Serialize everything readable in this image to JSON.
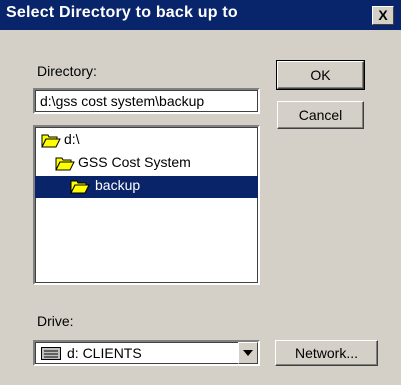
{
  "window": {
    "title": "Select Directory to back up to",
    "close_label": "X"
  },
  "directory": {
    "label": "Directory:",
    "value": "d:\\gss cost system\\backup"
  },
  "tree": {
    "items": [
      {
        "label": "d:\\",
        "icon": "open-folder-icon",
        "selected": false
      },
      {
        "label": "GSS Cost System",
        "icon": "open-folder-icon",
        "selected": false
      },
      {
        "label": "backup",
        "icon": "open-folder-icon",
        "selected": true
      }
    ]
  },
  "drive": {
    "label": "Drive:",
    "value": "d: CLIENTS",
    "icon": "drive-icon"
  },
  "buttons": {
    "ok": "OK",
    "cancel": "Cancel",
    "network": "Network..."
  },
  "colors": {
    "titlebar": "#08246b",
    "selection": "#0a246a",
    "dialog_bg": "#d4d0c8",
    "folder": "#ffff00"
  }
}
